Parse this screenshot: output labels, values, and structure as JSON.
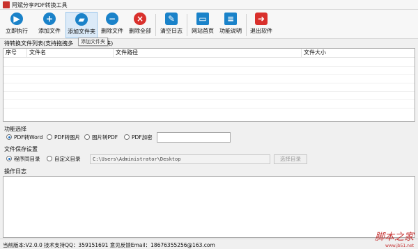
{
  "window": {
    "title": "阿斌分享PDF转换工具"
  },
  "toolbar": {
    "buttons": [
      {
        "label": "立即执行",
        "icon": "play-icon",
        "color": "#1a82c9"
      },
      {
        "label": "添加文件",
        "icon": "add-icon",
        "color": "#1a82c9"
      },
      {
        "label": "添加文件夹",
        "icon": "folder-icon",
        "color": "#1a82c9"
      },
      {
        "label": "删除文件",
        "icon": "minus-icon",
        "color": "#1a82c9"
      },
      {
        "label": "删除全部",
        "icon": "delete-all-icon",
        "color": "#d9302c"
      },
      {
        "label": "清空日志",
        "icon": "brush-icon",
        "color": "#1a82c9"
      },
      {
        "label": "网站首页",
        "icon": "monitor-icon",
        "color": "#1a82c9"
      },
      {
        "label": "功能说明",
        "icon": "document-icon",
        "color": "#1a82c9"
      },
      {
        "label": "退出软件",
        "icon": "exit-icon",
        "color": "#d9302c"
      }
    ],
    "tooltip": "添加文件夹"
  },
  "file_list": {
    "label": "待转换文件列表(支持拖拽多",
    "label_tail": "夹)",
    "columns": [
      "序号",
      "文件名",
      "文件路径",
      "文件大小"
    ],
    "rows": []
  },
  "function_select": {
    "label": "功能选择",
    "options": [
      {
        "label": "PDF转Word",
        "checked": true
      },
      {
        "label": "PDF转图片",
        "checked": false
      },
      {
        "label": "图片转PDF",
        "checked": false
      },
      {
        "label": "PDF加密",
        "checked": false
      }
    ],
    "password_value": ""
  },
  "save_settings": {
    "label": "文件保存设置",
    "options": [
      {
        "label": "程序同目录",
        "checked": true
      },
      {
        "label": "自定义目录",
        "checked": false
      }
    ],
    "path_value": "C:\\Users\\Administrator\\Desktop",
    "select_dir_label": "选择目录"
  },
  "log": {
    "label": "操作日志",
    "content": ""
  },
  "status": {
    "text": "当前版本:V2.0.0   技术支持QQ：359151691   意见反馈Email：18676355256@163.com"
  },
  "watermark": {
    "main": "脚本之家",
    "sub": "www.jb51.net"
  }
}
